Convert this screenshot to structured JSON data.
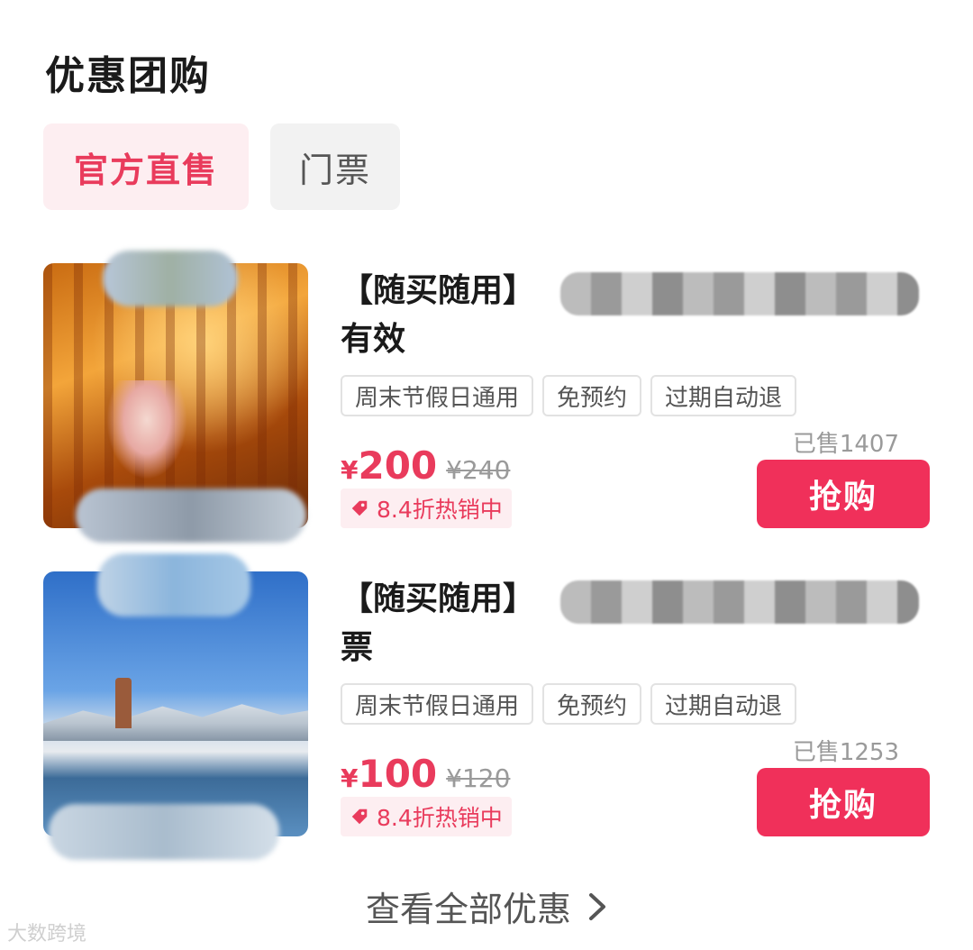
{
  "section": {
    "title": "优惠团购"
  },
  "tabs": [
    {
      "label": "官方直售",
      "active": true
    },
    {
      "label": "门票",
      "active": false
    }
  ],
  "deals": [
    {
      "title_prefix": "【随买随用】",
      "title_line2": "有效",
      "tags": [
        "周末节假日通用",
        "免预约",
        "过期自动退"
      ],
      "sold": "已售1407",
      "price_symbol": "¥",
      "price": "200",
      "original_price": "¥240",
      "discount": "8.4折热销中",
      "buy_label": "抢购"
    },
    {
      "title_prefix": "【随买随用】",
      "title_line2": "票",
      "tags": [
        "周末节假日通用",
        "免预约",
        "过期自动退"
      ],
      "sold": "已售1253",
      "price_symbol": "¥",
      "price": "100",
      "original_price": "¥120",
      "discount": "8.4折热销中",
      "buy_label": "抢购"
    }
  ],
  "footer": {
    "view_all": "查看全部优惠"
  },
  "watermark": "大数跨境",
  "colors": {
    "accent": "#f0305a",
    "accent_text": "#e93b5c",
    "accent_bg": "#fdeef1"
  },
  "icons": [
    "price-tag-icon",
    "chevron-right-icon"
  ]
}
